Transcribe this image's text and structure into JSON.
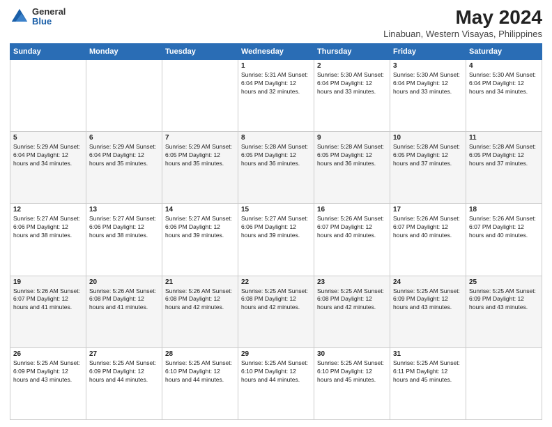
{
  "logo": {
    "general": "General",
    "blue": "Blue"
  },
  "title": "May 2024",
  "subtitle": "Linabuan, Western Visayas, Philippines",
  "days_of_week": [
    "Sunday",
    "Monday",
    "Tuesday",
    "Wednesday",
    "Thursday",
    "Friday",
    "Saturday"
  ],
  "weeks": [
    [
      {
        "day": "",
        "info": ""
      },
      {
        "day": "",
        "info": ""
      },
      {
        "day": "",
        "info": ""
      },
      {
        "day": "1",
        "info": "Sunrise: 5:31 AM\nSunset: 6:04 PM\nDaylight: 12 hours\nand 32 minutes."
      },
      {
        "day": "2",
        "info": "Sunrise: 5:30 AM\nSunset: 6:04 PM\nDaylight: 12 hours\nand 33 minutes."
      },
      {
        "day": "3",
        "info": "Sunrise: 5:30 AM\nSunset: 6:04 PM\nDaylight: 12 hours\nand 33 minutes."
      },
      {
        "day": "4",
        "info": "Sunrise: 5:30 AM\nSunset: 6:04 PM\nDaylight: 12 hours\nand 34 minutes."
      }
    ],
    [
      {
        "day": "5",
        "info": "Sunrise: 5:29 AM\nSunset: 6:04 PM\nDaylight: 12 hours\nand 34 minutes."
      },
      {
        "day": "6",
        "info": "Sunrise: 5:29 AM\nSunset: 6:04 PM\nDaylight: 12 hours\nand 35 minutes."
      },
      {
        "day": "7",
        "info": "Sunrise: 5:29 AM\nSunset: 6:05 PM\nDaylight: 12 hours\nand 35 minutes."
      },
      {
        "day": "8",
        "info": "Sunrise: 5:28 AM\nSunset: 6:05 PM\nDaylight: 12 hours\nand 36 minutes."
      },
      {
        "day": "9",
        "info": "Sunrise: 5:28 AM\nSunset: 6:05 PM\nDaylight: 12 hours\nand 36 minutes."
      },
      {
        "day": "10",
        "info": "Sunrise: 5:28 AM\nSunset: 6:05 PM\nDaylight: 12 hours\nand 37 minutes."
      },
      {
        "day": "11",
        "info": "Sunrise: 5:28 AM\nSunset: 6:05 PM\nDaylight: 12 hours\nand 37 minutes."
      }
    ],
    [
      {
        "day": "12",
        "info": "Sunrise: 5:27 AM\nSunset: 6:06 PM\nDaylight: 12 hours\nand 38 minutes."
      },
      {
        "day": "13",
        "info": "Sunrise: 5:27 AM\nSunset: 6:06 PM\nDaylight: 12 hours\nand 38 minutes."
      },
      {
        "day": "14",
        "info": "Sunrise: 5:27 AM\nSunset: 6:06 PM\nDaylight: 12 hours\nand 39 minutes."
      },
      {
        "day": "15",
        "info": "Sunrise: 5:27 AM\nSunset: 6:06 PM\nDaylight: 12 hours\nand 39 minutes."
      },
      {
        "day": "16",
        "info": "Sunrise: 5:26 AM\nSunset: 6:07 PM\nDaylight: 12 hours\nand 40 minutes."
      },
      {
        "day": "17",
        "info": "Sunrise: 5:26 AM\nSunset: 6:07 PM\nDaylight: 12 hours\nand 40 minutes."
      },
      {
        "day": "18",
        "info": "Sunrise: 5:26 AM\nSunset: 6:07 PM\nDaylight: 12 hours\nand 40 minutes."
      }
    ],
    [
      {
        "day": "19",
        "info": "Sunrise: 5:26 AM\nSunset: 6:07 PM\nDaylight: 12 hours\nand 41 minutes."
      },
      {
        "day": "20",
        "info": "Sunrise: 5:26 AM\nSunset: 6:08 PM\nDaylight: 12 hours\nand 41 minutes."
      },
      {
        "day": "21",
        "info": "Sunrise: 5:26 AM\nSunset: 6:08 PM\nDaylight: 12 hours\nand 42 minutes."
      },
      {
        "day": "22",
        "info": "Sunrise: 5:25 AM\nSunset: 6:08 PM\nDaylight: 12 hours\nand 42 minutes."
      },
      {
        "day": "23",
        "info": "Sunrise: 5:25 AM\nSunset: 6:08 PM\nDaylight: 12 hours\nand 42 minutes."
      },
      {
        "day": "24",
        "info": "Sunrise: 5:25 AM\nSunset: 6:09 PM\nDaylight: 12 hours\nand 43 minutes."
      },
      {
        "day": "25",
        "info": "Sunrise: 5:25 AM\nSunset: 6:09 PM\nDaylight: 12 hours\nand 43 minutes."
      }
    ],
    [
      {
        "day": "26",
        "info": "Sunrise: 5:25 AM\nSunset: 6:09 PM\nDaylight: 12 hours\nand 43 minutes."
      },
      {
        "day": "27",
        "info": "Sunrise: 5:25 AM\nSunset: 6:09 PM\nDaylight: 12 hours\nand 44 minutes."
      },
      {
        "day": "28",
        "info": "Sunrise: 5:25 AM\nSunset: 6:10 PM\nDaylight: 12 hours\nand 44 minutes."
      },
      {
        "day": "29",
        "info": "Sunrise: 5:25 AM\nSunset: 6:10 PM\nDaylight: 12 hours\nand 44 minutes."
      },
      {
        "day": "30",
        "info": "Sunrise: 5:25 AM\nSunset: 6:10 PM\nDaylight: 12 hours\nand 45 minutes."
      },
      {
        "day": "31",
        "info": "Sunrise: 5:25 AM\nSunset: 6:11 PM\nDaylight: 12 hours\nand 45 minutes."
      },
      {
        "day": "",
        "info": ""
      }
    ]
  ]
}
